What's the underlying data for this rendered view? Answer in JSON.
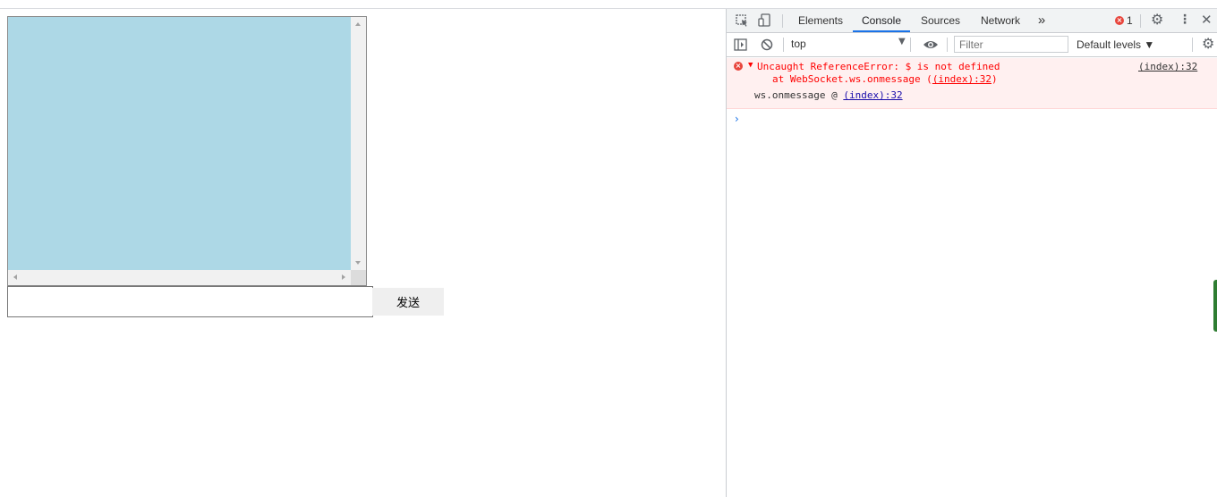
{
  "page": {
    "messages_box_color": "#add8e6",
    "message_input": {
      "value": "",
      "placeholder": ""
    },
    "send_button_label": "发送"
  },
  "devtools": {
    "tabs": [
      {
        "label": "Elements",
        "active": false
      },
      {
        "label": "Console",
        "active": true
      },
      {
        "label": "Sources",
        "active": false
      },
      {
        "label": "Network",
        "active": false
      }
    ],
    "more_tabs_glyph": "»",
    "error_count": "1",
    "toolbar": {
      "context": "top",
      "filter_placeholder": "Filter",
      "levels": "Default levels ▼"
    },
    "console": {
      "error_line": "Uncaught ReferenceError: $ is not defined",
      "error_source": "(index):32",
      "stack_prefix": "at WebSocket.ws.onmessage (",
      "stack_link": "(index):32",
      "stack_suffix": ")",
      "trace_prefix": "ws.onmessage @ ",
      "trace_link": "(index):32"
    },
    "colors": {
      "accent": "#1a73e8",
      "error": "#ff0000",
      "error_bg": "#fff0f0"
    }
  }
}
